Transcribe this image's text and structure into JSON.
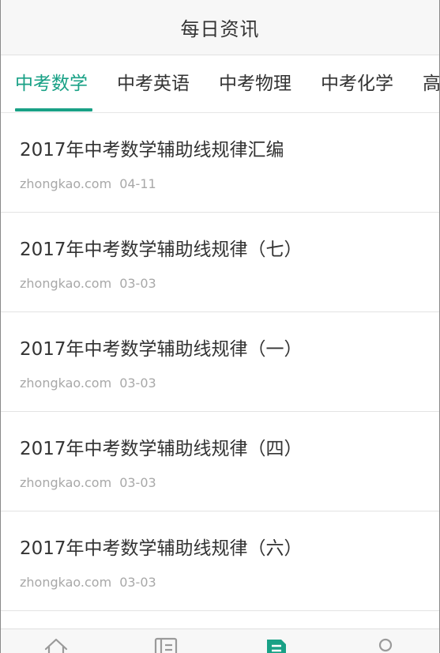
{
  "header": {
    "title": "每日资讯"
  },
  "tabs": [
    {
      "label": "中考数学",
      "active": true
    },
    {
      "label": "中考英语",
      "active": false
    },
    {
      "label": "中考物理",
      "active": false
    },
    {
      "label": "中考化学",
      "active": false
    },
    {
      "label": "高",
      "active": false
    }
  ],
  "articles": [
    {
      "title": "2017年中考数学辅助线规律汇编",
      "source": "zhongkao.com",
      "date": "04-11"
    },
    {
      "title": "2017年中考数学辅助线规律（七）",
      "source": "zhongkao.com",
      "date": "03-03"
    },
    {
      "title": "2017年中考数学辅助线规律（一）",
      "source": "zhongkao.com",
      "date": "03-03"
    },
    {
      "title": "2017年中考数学辅助线规律（四）",
      "source": "zhongkao.com",
      "date": "03-03"
    },
    {
      "title": "2017年中考数学辅助线规律（六）",
      "source": "zhongkao.com",
      "date": "03-03"
    }
  ],
  "bottom_nav": [
    {
      "icon": "home-icon",
      "active": false
    },
    {
      "icon": "list-icon",
      "active": false
    },
    {
      "icon": "news-icon",
      "active": true
    },
    {
      "icon": "user-icon",
      "active": false
    }
  ],
  "colors": {
    "accent": "#19a186",
    "text": "#333333",
    "meta": "#a8a8a8",
    "nav_inactive": "#9a9a9a"
  }
}
